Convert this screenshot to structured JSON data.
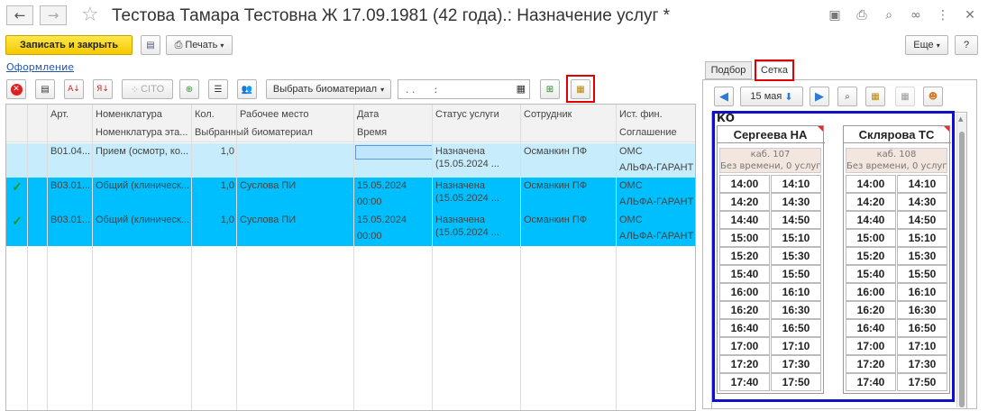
{
  "window": {
    "title": "Тестова Тамара Тестовна Ж 17.09.1981 (42 года).: Назначение услуг *"
  },
  "toolbar": {
    "save_close": "Записать и закрыть",
    "print": "Печать",
    "more": "Еще",
    "help": "?"
  },
  "form": {
    "link": "Оформление",
    "cito": "CITO",
    "select_biomaterial": "Выбрать биоматериал",
    "date_value": ". .      :"
  },
  "table": {
    "headers_top": [
      "Арт.",
      "Номенклатура",
      "Кол.",
      "Рабочее место",
      "Дата",
      "Статус услуги",
      "Сотрудник",
      "Ист. фин."
    ],
    "headers_bottom": [
      "",
      "Номенклатура эта...",
      "Выбранный биоматериал",
      "",
      "Время",
      "",
      "",
      "Соглашение"
    ],
    "rows": [
      {
        "check": "",
        "art": "B01.04...",
        "name": "Прием (осмотр, ко...",
        "qty": "1,0",
        "workplace": "",
        "date": "",
        "time": "",
        "status1": "Назначена",
        "status2": "(15.05.2024 ...",
        "employee": "Османкин ПФ",
        "fin": "ОМС",
        "agreement": "АЛЬФА-ГАРАНТ"
      },
      {
        "check": "✓",
        "art": "B03.01...",
        "name": "Общий (клиническ...",
        "qty": "1,0",
        "workplace": "Суслова ПИ",
        "date": "15.05.2024",
        "time": "00:00",
        "status1": "Назначена",
        "status2": "(15.05.2024 ...",
        "employee": "Османкин ПФ",
        "fin": "ОМС",
        "agreement": "АЛЬФА-ГАРАНТ"
      },
      {
        "check": "✓",
        "art": "B03.01...",
        "name": "Общий (клиническ...",
        "qty": "1,0",
        "workplace": "Суслова ПИ",
        "date": "15.05.2024",
        "time": "00:00",
        "status1": "Назначена",
        "status2": "(15.05.2024 ...",
        "employee": "Османкин ПФ",
        "fin": "ОМС",
        "agreement": "АЛЬФА-ГАРАНТ"
      }
    ]
  },
  "right_panel": {
    "tabs": [
      "Подбор",
      "Сетка"
    ],
    "active_tab": "Сетка",
    "date_btn": "15 мая",
    "grid_label": "КО",
    "doctors": [
      {
        "name": "Сергеева НА",
        "cabinet": "каб. 107",
        "note": "Без времени, 0 услуг",
        "slots": [
          "14:00",
          "14:10",
          "14:20",
          "14:30",
          "14:40",
          "14:50",
          "15:00",
          "15:10",
          "15:20",
          "15:30",
          "15:40",
          "15:50",
          "16:00",
          "16:10",
          "16:20",
          "16:30",
          "16:40",
          "16:50",
          "17:00",
          "17:10",
          "17:20",
          "17:30",
          "17:40",
          "17:50"
        ]
      },
      {
        "name": "Склярова ТС",
        "cabinet": "каб. 108",
        "note": "Без времени, 0 услуг",
        "slots": [
          "14:00",
          "14:10",
          "14:20",
          "14:30",
          "14:40",
          "14:50",
          "15:00",
          "15:10",
          "15:20",
          "15:30",
          "15:40",
          "15:50",
          "16:00",
          "16:10",
          "16:20",
          "16:30",
          "16:40",
          "16:50",
          "17:00",
          "17:10",
          "17:20",
          "17:30",
          "17:40",
          "17:50"
        ]
      }
    ]
  },
  "colors": {
    "accent_yellow": "#f5c800",
    "row_selected": "#00bfff",
    "row_light": "#c7ecfb",
    "highlight_red": "#e00000",
    "highlight_blue": "#1010c8"
  }
}
